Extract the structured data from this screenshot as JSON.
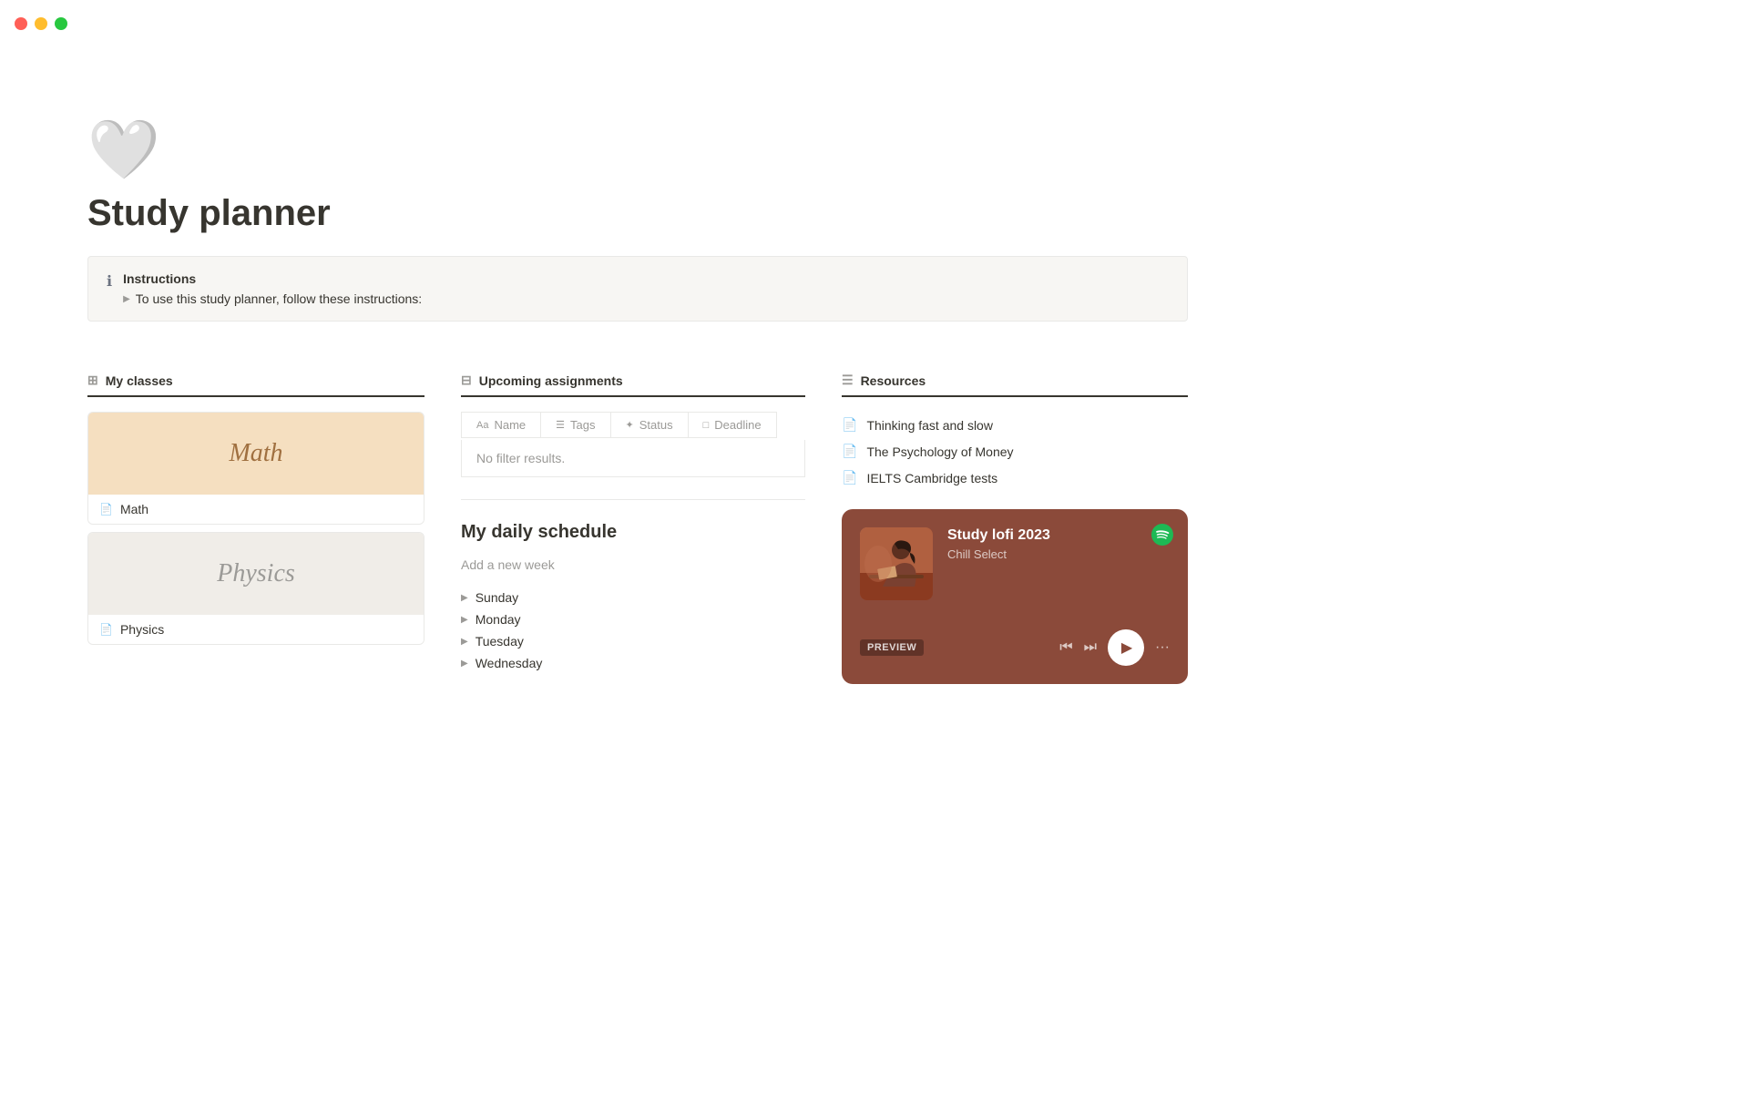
{
  "titlebar": {
    "traffic_lights": [
      "red",
      "yellow",
      "green"
    ]
  },
  "page": {
    "icon": "🤍",
    "title": "Study planner"
  },
  "callout": {
    "icon": "ℹ",
    "title": "Instructions",
    "toggle_text": "To use this study planner, follow these instructions:"
  },
  "my_classes": {
    "header_label": "My classes",
    "header_icon": "⊞",
    "classes": [
      {
        "name": "Math",
        "display_name": "Math",
        "bg": "math",
        "italic_label": "Math"
      },
      {
        "name": "Physics",
        "display_name": "Physics",
        "bg": "physics",
        "italic_label": "Physics"
      }
    ]
  },
  "upcoming_assignments": {
    "header_label": "Upcoming assignments",
    "header_icon": "⊟",
    "columns": [
      {
        "icon": "Aa",
        "label": "Name"
      },
      {
        "icon": "☰",
        "label": "Tags"
      },
      {
        "icon": "✦",
        "label": "Status"
      },
      {
        "icon": "□",
        "label": "Deadline"
      }
    ],
    "no_results_text": "No filter results."
  },
  "daily_schedule": {
    "title": "My daily schedule",
    "add_week_placeholder": "Add a new week",
    "days": [
      "Sunday",
      "Monday",
      "Tuesday",
      "Wednesday"
    ]
  },
  "resources": {
    "header_label": "Resources",
    "header_icon": "☰",
    "items": [
      {
        "icon": "📄",
        "label": "Thinking fast and slow"
      },
      {
        "icon": "📄",
        "label": "The Psychology of Money"
      },
      {
        "icon": "📄",
        "label": "IELTS Cambridge tests"
      }
    ]
  },
  "spotify": {
    "track_title": "Study lofi 2023",
    "track_subtitle": "Chill Select",
    "preview_label": "PREVIEW",
    "controls": {
      "prev": "⏮",
      "next": "⏭",
      "play": "▶",
      "more": "···"
    }
  }
}
